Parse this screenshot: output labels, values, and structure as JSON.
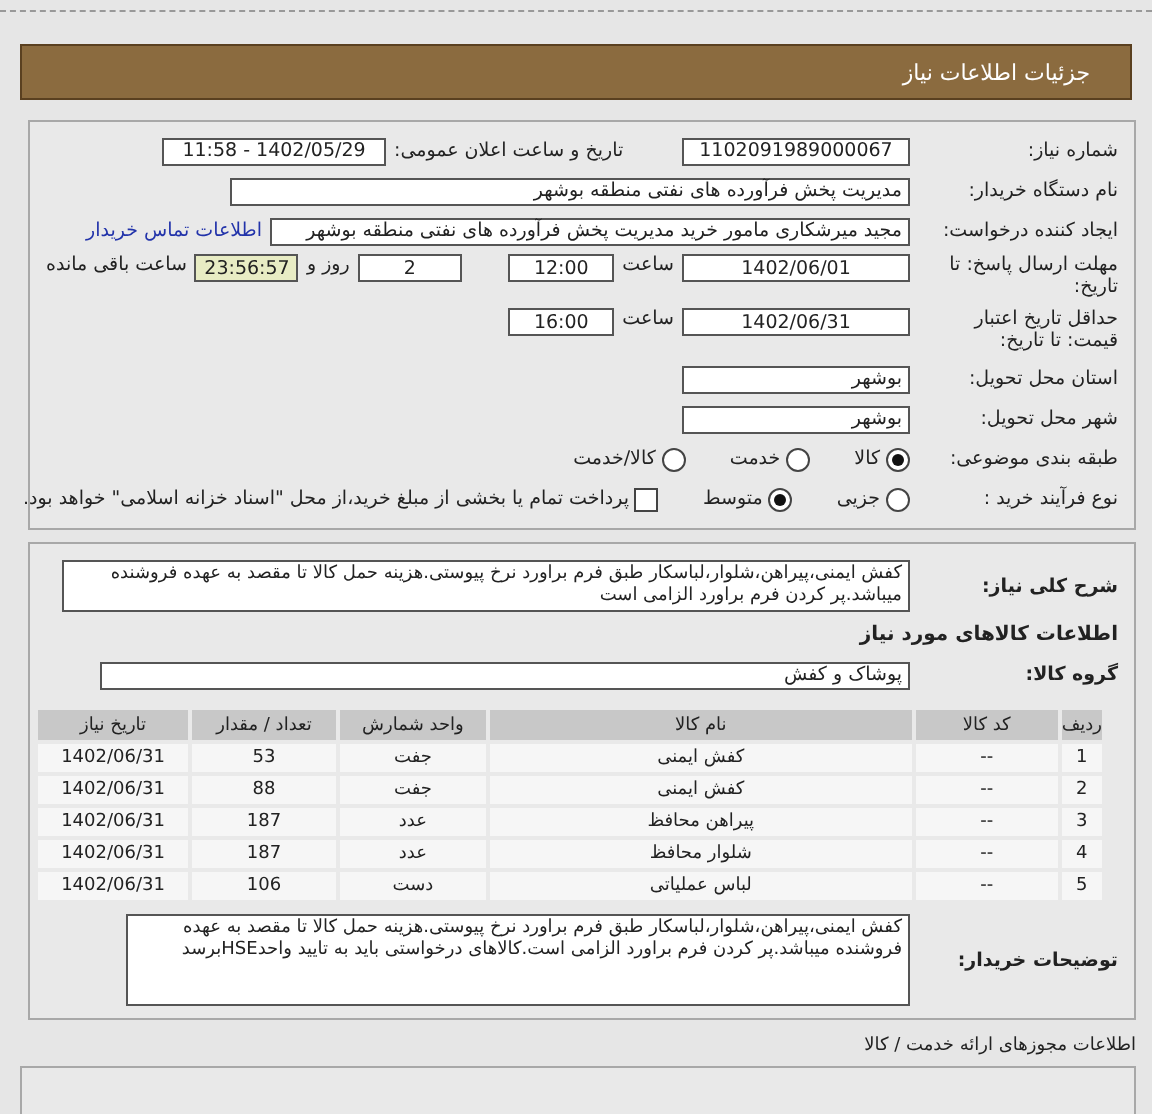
{
  "header": {
    "title": "جزئیات اطلاعات نیاز"
  },
  "details": {
    "need_number": {
      "label": "شماره نیاز:",
      "value": "1102091989000067"
    },
    "announce": {
      "label": "تاریخ و ساعت اعلان عمومی:",
      "value": "1402/05/29 - 11:58"
    },
    "buyer": {
      "label": "نام دستگاه خریدار:",
      "value": "مدیریت پخش فرآورده های نفتی منطقه بوشهر"
    },
    "creator": {
      "label": "ایجاد کننده درخواست:",
      "value": "مجید میرشکاری مامور خرید مدیریت پخش فرآورده های نفتی منطقه بوشهر",
      "link": "اطلاعات تماس خریدار"
    },
    "deadline": {
      "label": "مهلت ارسال پاسخ: تا تاریخ:",
      "date": "1402/06/01",
      "time_label": "ساعت",
      "time": "12:00",
      "days": "2",
      "days_label": "روز و",
      "remaining": "23:56:57",
      "remaining_label": "ساعت باقی مانده"
    },
    "validity": {
      "label": "حداقل تاریخ اعتبار قیمت: تا تاریخ:",
      "date": "1402/06/31",
      "time_label": "ساعت",
      "time": "16:00"
    },
    "province": {
      "label": "استان محل تحویل:",
      "value": "بوشهر"
    },
    "city": {
      "label": "شهر محل تحویل:",
      "value": "بوشهر"
    },
    "category": {
      "label": "طبقه بندی موضوعی:",
      "options": [
        {
          "label": "کالا",
          "selected": true
        },
        {
          "label": "خدمت",
          "selected": false
        },
        {
          "label": "کالا/خدمت",
          "selected": false
        }
      ]
    },
    "purchase_type": {
      "label": "نوع فرآیند خرید :",
      "options": [
        {
          "label": "جزیی",
          "selected": false
        },
        {
          "label": "متوسط",
          "selected": true
        }
      ],
      "payment": {
        "label": "پرداخت تمام یا بخشی از مبلغ خرید،از محل \"اسناد خزانه اسلامی\" خواهد بود.",
        "checked": false
      }
    }
  },
  "summary": {
    "label": "شرح کلی نیاز:",
    "value": "کفش ایمنی،پیراهن،شلوار،لباسکار طبق فرم براورد نرخ پیوستی.هزینه حمل کالا تا مقصد به عهده فروشنده میباشد.پر کردن فرم براورد الزامی است"
  },
  "goods_heading": "اطلاعات کالاهای مورد نیاز",
  "group": {
    "label": "گروه کالا:",
    "value": "پوشاک و کفش"
  },
  "table": {
    "columns": [
      "ردیف",
      "کد کالا",
      "نام کالا",
      "واحد شمارش",
      "تعداد / مقدار",
      "تاریخ نیاز"
    ],
    "rows": [
      [
        "1",
        "--",
        "کفش ایمنی",
        "جفت",
        "53",
        "1402/06/31"
      ],
      [
        "2",
        "--",
        "کفش ایمنی",
        "جفت",
        "88",
        "1402/06/31"
      ],
      [
        "3",
        "--",
        "پیراهن محافظ",
        "عدد",
        "187",
        "1402/06/31"
      ],
      [
        "4",
        "--",
        "شلوار محافظ",
        "عدد",
        "187",
        "1402/06/31"
      ],
      [
        "5",
        "--",
        "لباس عملیاتی",
        "دست",
        "106",
        "1402/06/31"
      ]
    ]
  },
  "buyer_notes": {
    "label": "توضیحات خریدار:",
    "value": "کفش ایمنی،پیراهن،شلوار،لباسکار طبق فرم براورد نرخ پیوستی.هزینه حمل کالا تا مقصد به عهده فروشنده میباشد.پر کردن فرم براورد الزامی است.کالاهای درخواستی باید به تایید واحدHSEبرسد"
  },
  "permits": {
    "title": "اطلاعات مجوزهای ارائه خدمت / کالا"
  }
}
